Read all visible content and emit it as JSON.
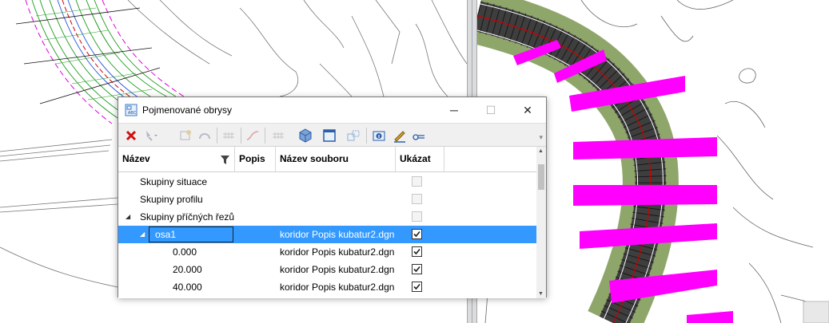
{
  "dialog": {
    "title": "Pojmenované obrysy",
    "app_icon": "abc-outline-icon",
    "window_buttons": {
      "minimize": "─",
      "maximize": "☐",
      "close": "✕"
    }
  },
  "toolbar": {
    "icons": [
      "delete-icon",
      "select-dropdown-icon",
      "add-outline-icon",
      "arc-icon",
      "grid-icon",
      "curve-icon",
      "grid2-icon",
      "cube-view-icon",
      "fit-view-icon",
      "window-area-icon",
      "info-icon",
      "edit-pen-icon",
      "key-link-icon"
    ]
  },
  "grid": {
    "columns": {
      "name": "Název",
      "popis": "Popis",
      "file": "Název souboru",
      "show": "Ukázat"
    },
    "rows": [
      {
        "name": "Skupiny situace",
        "popis": "",
        "file": "",
        "show": false
      },
      {
        "name": "Skupiny profilu",
        "popis": "",
        "file": "",
        "show": false
      },
      {
        "name": "Skupiny příčných řezů",
        "popis": "",
        "file": "",
        "show": false
      },
      {
        "name": "osa1",
        "popis": "",
        "file": "koridor Popis kubatur2.dgn",
        "show": true
      },
      {
        "name": "0.000",
        "popis": "",
        "file": "koridor Popis kubatur2.dgn",
        "show": true
      },
      {
        "name": "20.000",
        "popis": "",
        "file": "koridor Popis kubatur2.dgn",
        "show": true
      },
      {
        "name": "40.000",
        "popis": "",
        "file": "koridor Popis kubatur2.dgn",
        "show": true
      }
    ]
  },
  "colors": {
    "selection": "#3399ff",
    "section_magenta": "#ff00ff",
    "corridor_green": "#8fa66a"
  }
}
